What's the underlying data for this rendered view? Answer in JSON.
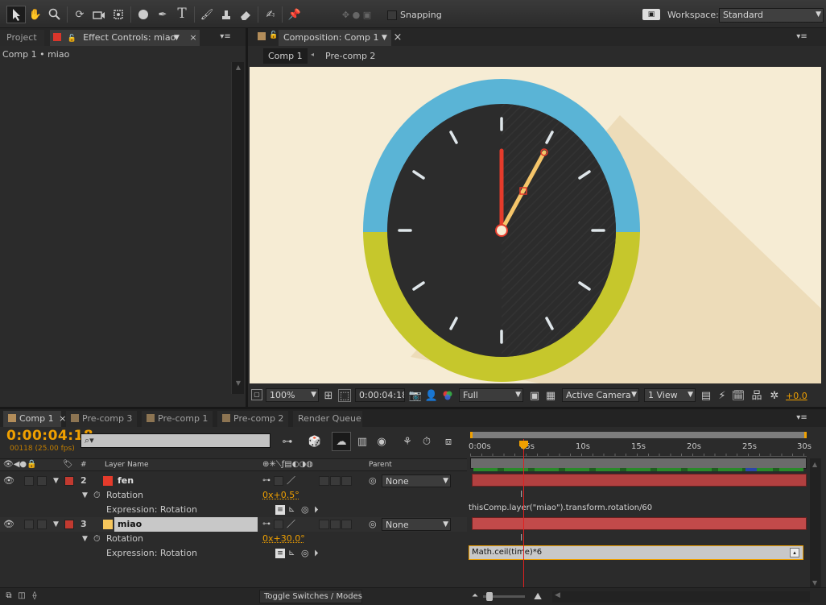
{
  "toolbar": {
    "snapping_label": "Snapping",
    "workspace_label": "Workspace:",
    "workspace_value": "Standard"
  },
  "left_panel": {
    "tab_project": "Project",
    "tab_effect_controls": "Effect Controls: miao",
    "breadcrumb": "Comp 1 • miao"
  },
  "comp_panel": {
    "tab_title": "Composition: Comp 1",
    "nav_comp1": "Comp 1",
    "nav_precomp2": "Pre-comp 2",
    "footer": {
      "zoom": "100%",
      "timecode": "0:00:04:18",
      "resolution": "Full",
      "camera": "Active Camera",
      "view": "1 View",
      "exposure": "+0.0"
    }
  },
  "timeline": {
    "tabs": [
      "Comp 1",
      "Pre-comp 3",
      "Pre-comp 1",
      "Pre-comp 2",
      "Render Queue"
    ],
    "timecode": "0:00:04:18",
    "frame_info": "00118 (25.00 fps)",
    "search_placeholder": "",
    "col_number": "#",
    "col_layer_name": "Layer Name",
    "col_parent": "Parent",
    "ruler_labels": [
      "0:00s",
      "05s",
      "10s",
      "15s",
      "20s",
      "25s",
      "30s"
    ],
    "layers": [
      {
        "num": "2",
        "name": "fen",
        "color": "#e53b2b",
        "parent": "None",
        "prop": "Rotation",
        "prop_value": "0x+0.5°",
        "expr_label": "Expression: Rotation",
        "expr": "thisComp.layer(\"miao\").transform.rotation/60"
      },
      {
        "num": "3",
        "name": "miao",
        "color": "#f7c65b",
        "parent": "None",
        "prop": "Rotation",
        "prop_value": "0x+30.0°",
        "expr_label": "Expression: Rotation",
        "expr": "Math.ceil(time)*6"
      }
    ],
    "toggle_label": "Toggle Switches / Modes"
  },
  "colors": {
    "accent_orange": "#f0a000",
    "clock_blue": "#5ab4d6",
    "clock_yellow": "#c6c72c",
    "clock_face": "#2c2c2c",
    "canvas_bg": "#f6ecd4",
    "playhead": "#e02020"
  }
}
